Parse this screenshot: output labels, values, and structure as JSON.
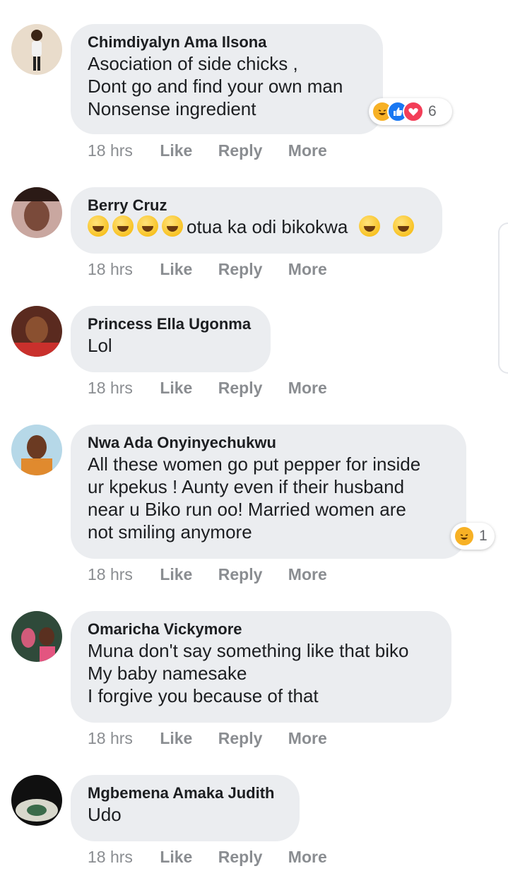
{
  "colors": {
    "bubble": "#ebedf0",
    "meta_text": "#8a8d91",
    "haha": "#f7b125",
    "like": "#1877f2",
    "love": "#f33e58"
  },
  "comments": [
    {
      "author": "Chimdiyalyn Ama Ilsona",
      "text": "Asociation of side chicks ,\nDont go and find your own man\nNonsense ingredient",
      "time": "18 hrs",
      "like": "Like",
      "reply": "Reply",
      "more": "More",
      "reactions": [
        "haha-icon",
        "like-icon",
        "love-icon"
      ],
      "reaction_count": "6"
    },
    {
      "author": "Berry Cruz",
      "text_mid": "otua ka odi bikokwa",
      "emojis_before": [
        "joy-emoji",
        "joy-emoji",
        "joy-emoji",
        "joy-emoji"
      ],
      "emojis_after": [
        "sweat-smile-emoji",
        "sweat-smile-emoji"
      ],
      "time": "18 hrs",
      "like": "Like",
      "reply": "Reply",
      "more": "More"
    },
    {
      "author": "Princess Ella Ugonma",
      "text": "Lol",
      "time": "18 hrs",
      "like": "Like",
      "reply": "Reply",
      "more": "More"
    },
    {
      "author": "Nwa Ada Onyinyechukwu",
      "text": "All these women go put pepper for inside\nur kpekus ! Aunty even if their husband\nnear u Biko run oo! Married women are\nnot smiling anymore",
      "time": "18 hrs",
      "like": "Like",
      "reply": "Reply",
      "more": "More",
      "reactions": [
        "haha-icon"
      ],
      "reaction_count": "1"
    },
    {
      "author": "Omaricha Vickymore",
      "text": "Muna don't say something like that biko\nMy baby namesake\nI forgive you because of that",
      "time": "18 hrs",
      "like": "Like",
      "reply": "Reply",
      "more": "More"
    },
    {
      "author": "Mgbemena Amaka Judith",
      "text": "Udo",
      "time": "18 hrs",
      "like": "Like",
      "reply": "Reply",
      "more": "More"
    }
  ]
}
